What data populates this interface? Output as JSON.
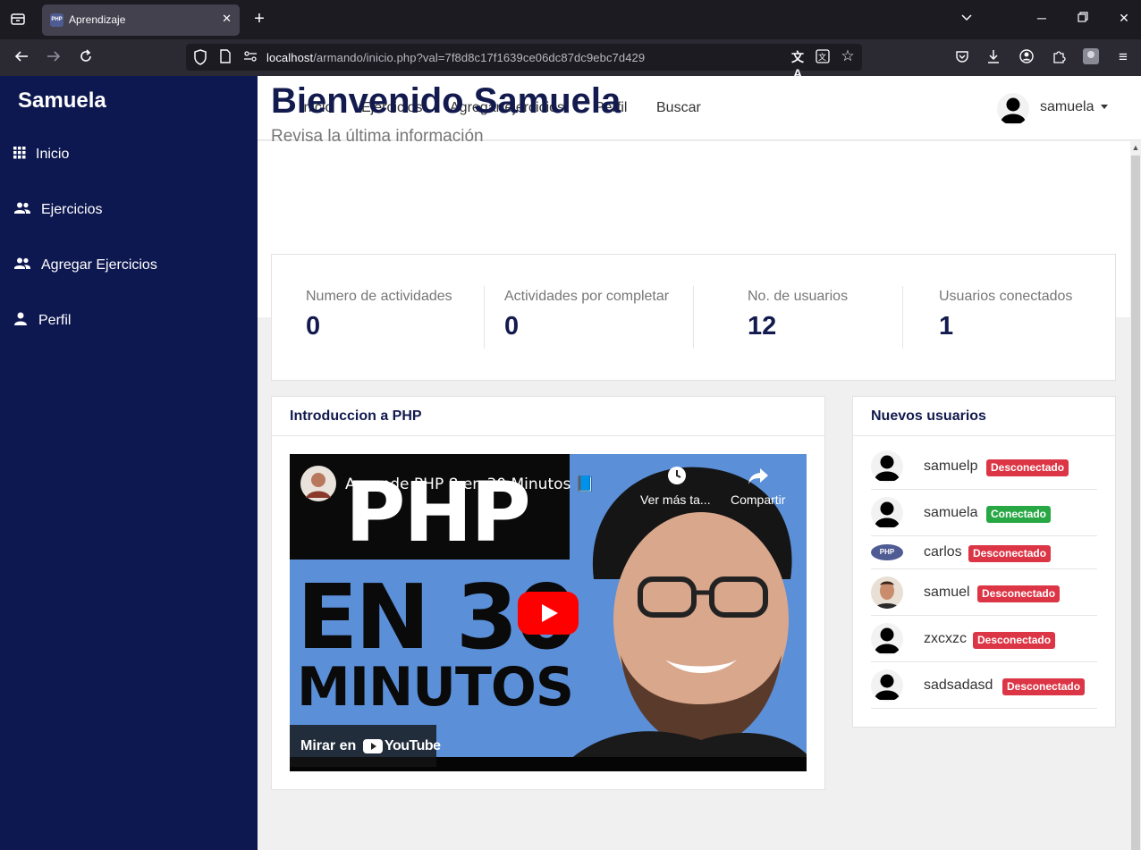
{
  "browser": {
    "tab_title": "Aprendizaje",
    "tab_favicon_text": "PHP",
    "url_host": "localhost",
    "url_path": "/armando/inicio.php?val=7f8d8c17f1639ce06dc87dc9ebc7d429"
  },
  "sidebar": {
    "brand": "Samuela",
    "items": [
      {
        "label": "Inicio",
        "icon": "grid-icon"
      },
      {
        "label": "Ejercicios",
        "icon": "users-icon"
      },
      {
        "label": "Agregar Ejercicios",
        "icon": "users-icon"
      },
      {
        "label": "Perfil",
        "icon": "user-icon"
      }
    ]
  },
  "topnav": {
    "links": [
      "Inicio",
      "Ejercicios",
      "Agregar ejercicios",
      "Perfil",
      "Buscar"
    ],
    "user_name": "samuela"
  },
  "header": {
    "title": "Bienvenido Samuela",
    "subtitle": "Revisa la última información"
  },
  "stats": [
    {
      "label": "Numero de actividades",
      "value": "0"
    },
    {
      "label": "Actividades por completar",
      "value": "0"
    },
    {
      "label": "No. de usuarios",
      "value": "12"
    },
    {
      "label": "Usuarios conectados",
      "value": "1"
    }
  ],
  "video_card": {
    "title": "Introduccion a PHP",
    "video_title": "Aprende PHP 8 en 30 Minutos 📘",
    "watch_later": "Ver más ta...",
    "share": "Compartir",
    "thumb_line1": "PHP",
    "thumb_line2": "EN 30",
    "thumb_line3": "MINUTOS",
    "watch_on": "Mirar en",
    "youtube": "YouTube"
  },
  "users_card": {
    "title": "Nuevos usuarios",
    "users": [
      {
        "name": "samuelp",
        "status": "Desconectado",
        "online": false,
        "avatar": "silhouette"
      },
      {
        "name": "samuela",
        "status": "Conectado",
        "online": true,
        "avatar": "silhouette"
      },
      {
        "name": "carlos",
        "status": "Desconectado",
        "online": false,
        "avatar": "php-logo"
      },
      {
        "name": "samuel",
        "status": "Desconectado",
        "online": false,
        "avatar": "photo"
      },
      {
        "name": "zxcxzc",
        "status": "Desconectado",
        "online": false,
        "avatar": "silhouette"
      },
      {
        "name": "sadsadasd",
        "status": "Desconectado",
        "online": false,
        "avatar": "silhouette"
      }
    ],
    "php_logo_text": "PHP"
  },
  "colors": {
    "sidebar_bg": "#0e1850",
    "heading": "#121a4e",
    "badge_offline": "#dc3545",
    "badge_online": "#28a745"
  }
}
